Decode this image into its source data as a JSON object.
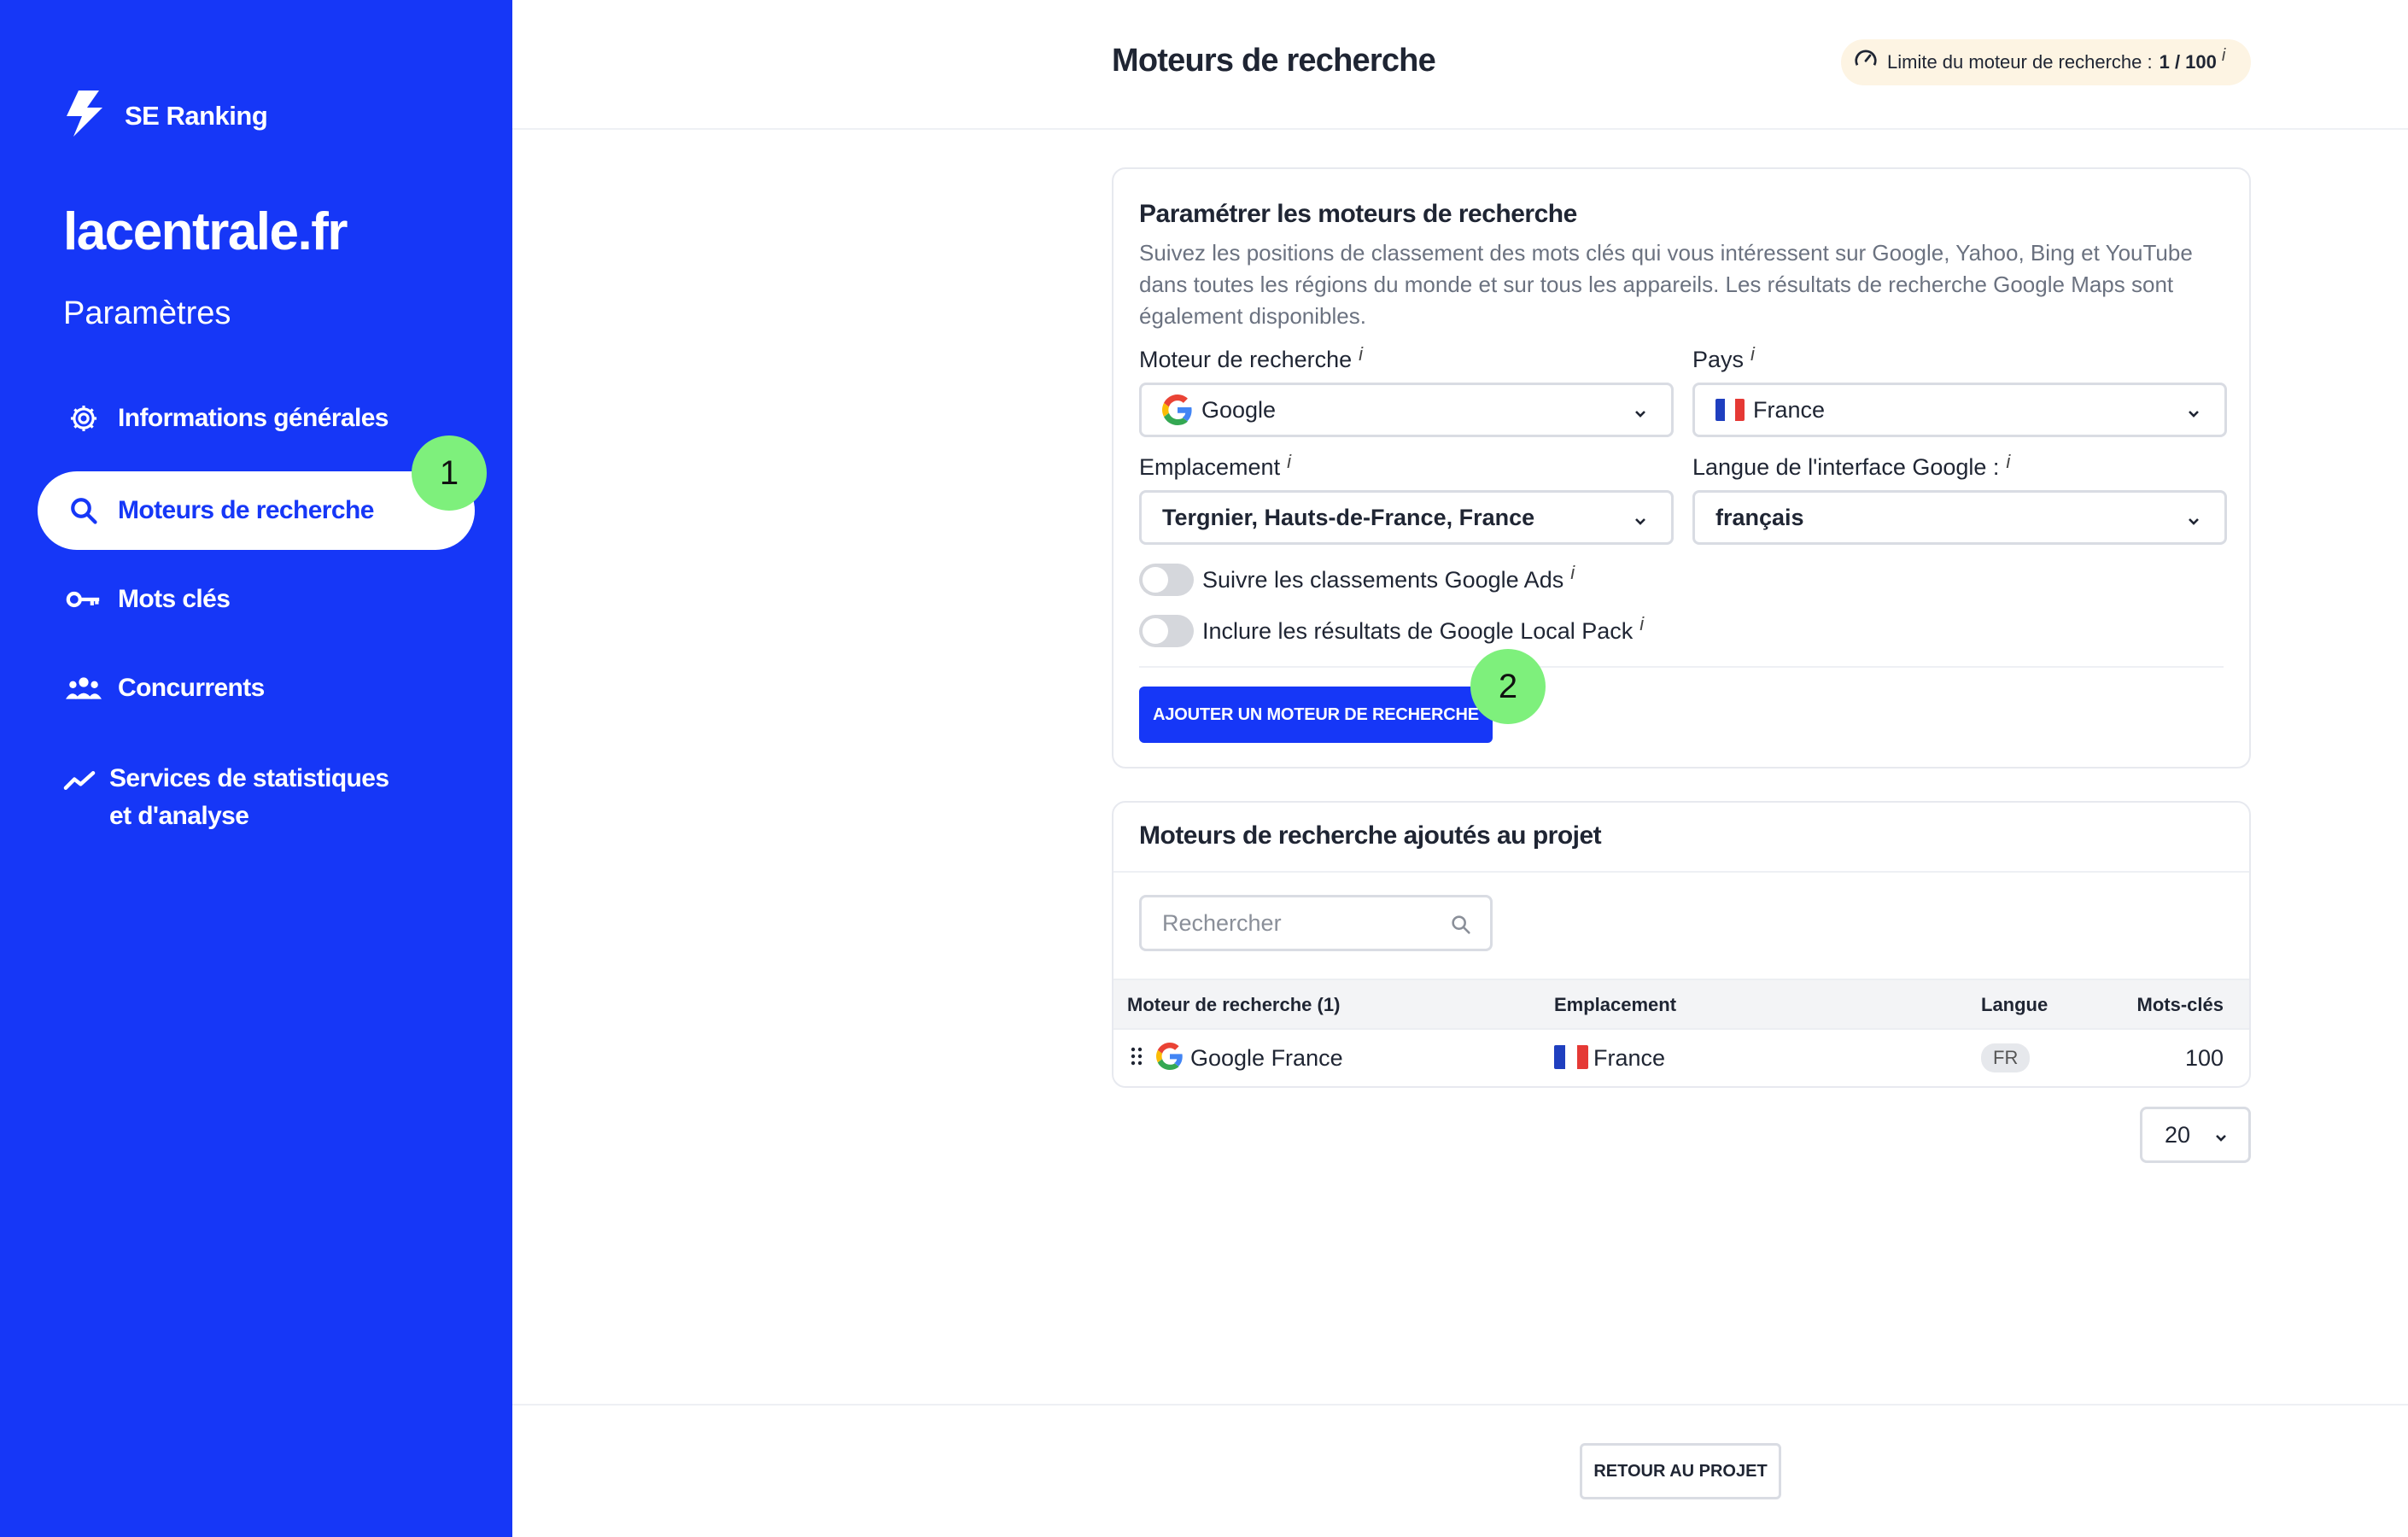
{
  "sidebar": {
    "brand": "SE Ranking",
    "project": "lacentrale.fr",
    "section": "Paramètres",
    "items": [
      {
        "label": "Informations générales"
      },
      {
        "label": "Moteurs de recherche"
      },
      {
        "label": "Mots clés"
      },
      {
        "label": "Concurrents"
      },
      {
        "label": "Services de statistiques et d'analyse"
      }
    ],
    "step1": "1"
  },
  "header": {
    "title": "Moteurs de recherche",
    "limit_label": "Limite du moteur de recherche :",
    "limit_value": "1 / 100",
    "info": "i"
  },
  "settings": {
    "title": "Paramétrer les moteurs de recherche",
    "description": "Suivez les positions de classement des mots clés qui vous intéressent sur Google, Yahoo, Bing et YouTube dans toutes les régions du monde et sur tous les appareils. Les résultats de recherche Google Maps sont également disponibles.",
    "engine_label": "Moteur de recherche",
    "engine_value": "Google",
    "country_label": "Pays",
    "country_value": "France",
    "location_label": "Emplacement",
    "location_value": "Tergnier, Hauts-de-France, France",
    "language_label": "Langue de l'interface Google :",
    "language_value": "français",
    "toggle_ads": "Suivre les classements Google Ads",
    "toggle_local": "Inclure les résultats de Google Local Pack",
    "add_button": "AJOUTER UN MOTEUR DE RECHERCHE",
    "step2": "2",
    "info": "i"
  },
  "added": {
    "title": "Moteurs de recherche ajoutés au projet",
    "search_placeholder": "Rechercher",
    "columns": [
      "Moteur de recherche (1)",
      "Emplacement",
      "Langue",
      "Mots-clés"
    ],
    "rows": [
      {
        "engine": "Google France",
        "location": "France",
        "lang": "FR",
        "keywords": "100"
      }
    ],
    "page_size": "20"
  },
  "footer": {
    "back_button": "RETOUR AU PROJET"
  },
  "colors": {
    "brand_blue": "#1637f7",
    "step_green": "#7ef07c",
    "limit_bg": "#fdf4e3"
  },
  "icons": {
    "logo": "lightning-icon",
    "general": "gear-icon",
    "engines": "search-icon",
    "keywords": "key-icon",
    "competitors": "users-icon",
    "analytics": "trend-icon"
  }
}
